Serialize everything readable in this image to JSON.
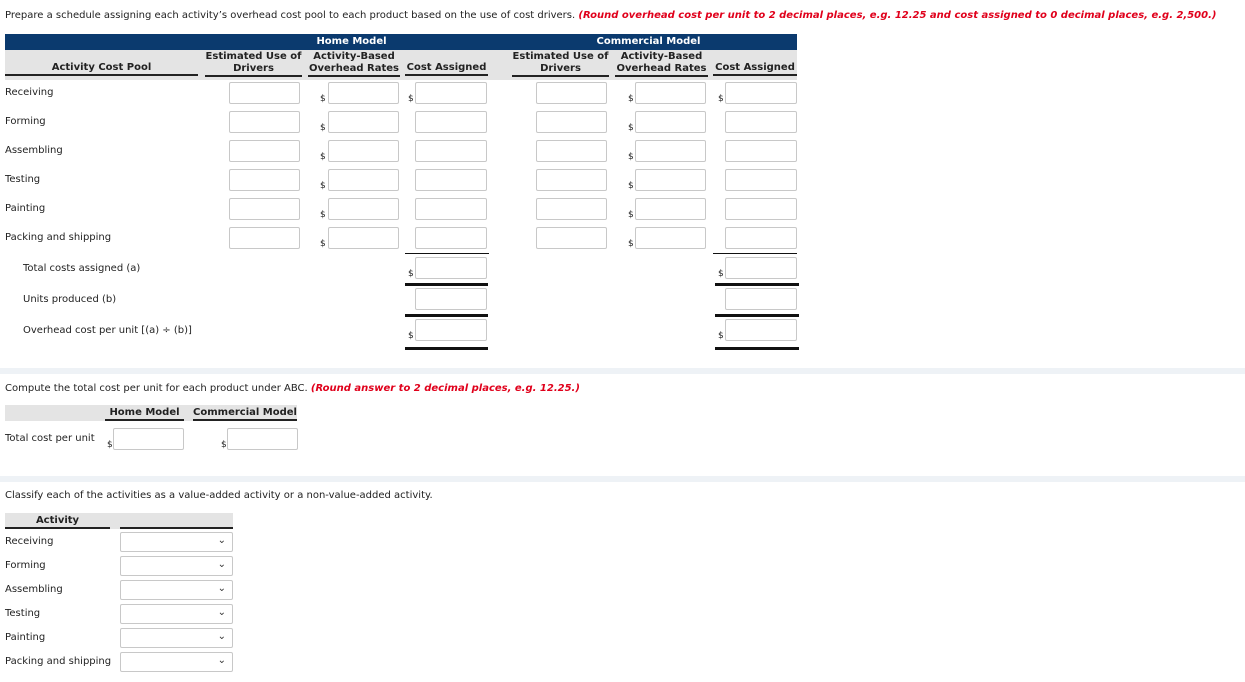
{
  "schedule": {
    "instruction": "Prepare a schedule assigning each activity’s overhead cost pool to each product based on the use of cost drivers.",
    "note": "(Round overhead cost per unit to 2 decimal places, e.g. 12.25 and cost assigned to 0 decimal places, e.g. 2,500.)",
    "home_model": "Home Model",
    "commercial_model": "Commercial Model",
    "col_pool": "Activity Cost Pool",
    "col_drivers": "Estimated Use of Drivers",
    "col_rates": "Activity-Based Overhead Rates",
    "col_cost": "Cost Assigned",
    "currency": "$",
    "activities": [
      "Receiving",
      "Forming",
      "Assembling",
      "Testing",
      "Painting",
      "Packing and shipping"
    ],
    "totals": [
      "Total costs assigned (a)",
      "Units produced (b)",
      "Overhead cost per unit [(a) ÷ (b)]"
    ]
  },
  "unit_cost": {
    "instruction": "Compute the total cost per unit for each product under ABC.",
    "note": "(Round answer to 2 decimal places, e.g. 12.25.)",
    "home_model": "Home Model",
    "commercial_model": "Commercial Model",
    "row_label": "Total cost per unit",
    "currency": "$"
  },
  "classify": {
    "instruction": "Classify each of the activities as a value-added activity or a non-value-added activity.",
    "col_activity": "Activity",
    "activities": [
      "Receiving",
      "Forming",
      "Assembling",
      "Testing",
      "Painting",
      "Packing and shipping"
    ]
  },
  "colors": {
    "header_bar": "#0b3a6e",
    "note_red": "#e0001b"
  }
}
